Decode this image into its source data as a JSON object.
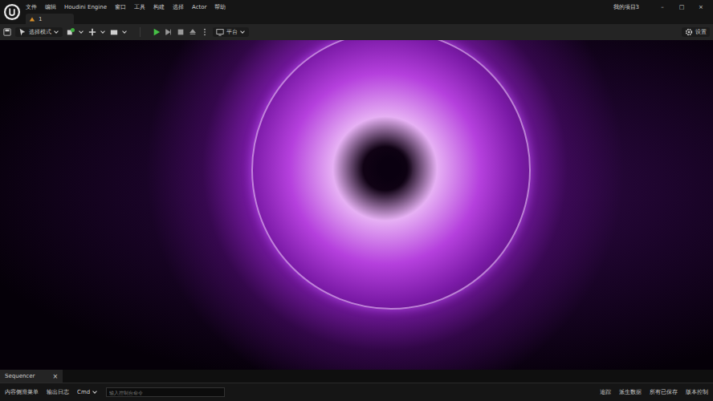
{
  "window": {
    "title": "我的项目3",
    "controls": [
      "–",
      "□",
      "×"
    ]
  },
  "menu": [
    "文件",
    "编辑",
    "Houdini Engine",
    "窗口",
    "工具",
    "构建",
    "选择",
    "Actor",
    "帮助"
  ],
  "level_tab": {
    "label": "1"
  },
  "toolbar": {
    "mode": "选择模式",
    "platform": "平台",
    "settings": "设置"
  },
  "bottom_tabs": [
    {
      "label": "Sequencer",
      "selected": true,
      "close": "×"
    }
  ],
  "status_bar": {
    "left": [
      "内容侧滑菜单",
      "输出日志"
    ],
    "cmd": "Cmd",
    "console_placeholder": "输入控制台命令",
    "right": [
      "追踪",
      "派生数据",
      "所有已保存",
      "版本控制"
    ]
  }
}
